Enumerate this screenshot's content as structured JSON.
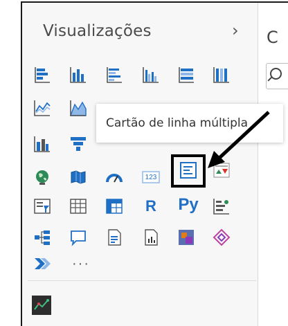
{
  "panel": {
    "title": "Visualizações",
    "collapse_glyph": "›",
    "right_title": "C"
  },
  "tooltip": {
    "text": "Cartão de linha múltipla"
  },
  "icons": {
    "r_label": "R",
    "py_label": "Py",
    "more_label": "···",
    "kpi_label": "123"
  },
  "colors": {
    "accent_blue": "#1f6fc5",
    "light_blue": "#8fb8e8",
    "green": "#2e8b57",
    "orange": "#e07b1a",
    "purple": "#8a3ab9",
    "pink": "#c040a0"
  }
}
